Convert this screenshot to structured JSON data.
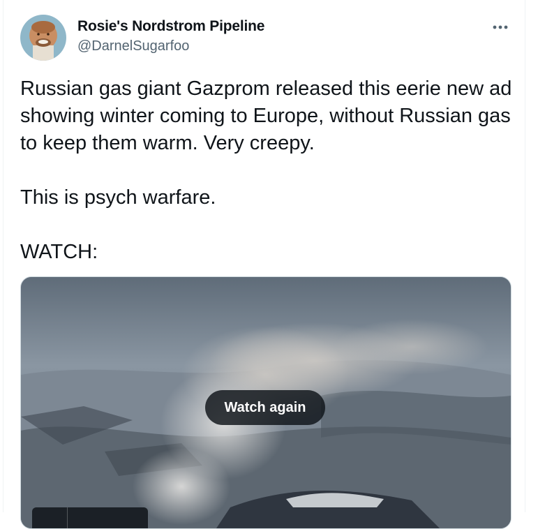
{
  "tweet": {
    "author": {
      "display_name": "Rosie's Nordstrom Pipeline",
      "handle": "@DarnelSugarfoo"
    },
    "more_icon": "more-horizontal-icon",
    "text": {
      "paragraph1": "Russian gas giant Gazprom released this eerie new ad showing winter coming to Europe, without Russian gas to keep them warm. Very creepy.",
      "paragraph2": "This is psych warfare.",
      "paragraph3": "WATCH:"
    },
    "media": {
      "type": "video",
      "watch_again_label": "Watch again"
    }
  },
  "colors": {
    "text_primary": "#0f1419",
    "text_secondary": "#536471",
    "border": "#cfd9de",
    "overlay_button": "#0f1419"
  }
}
